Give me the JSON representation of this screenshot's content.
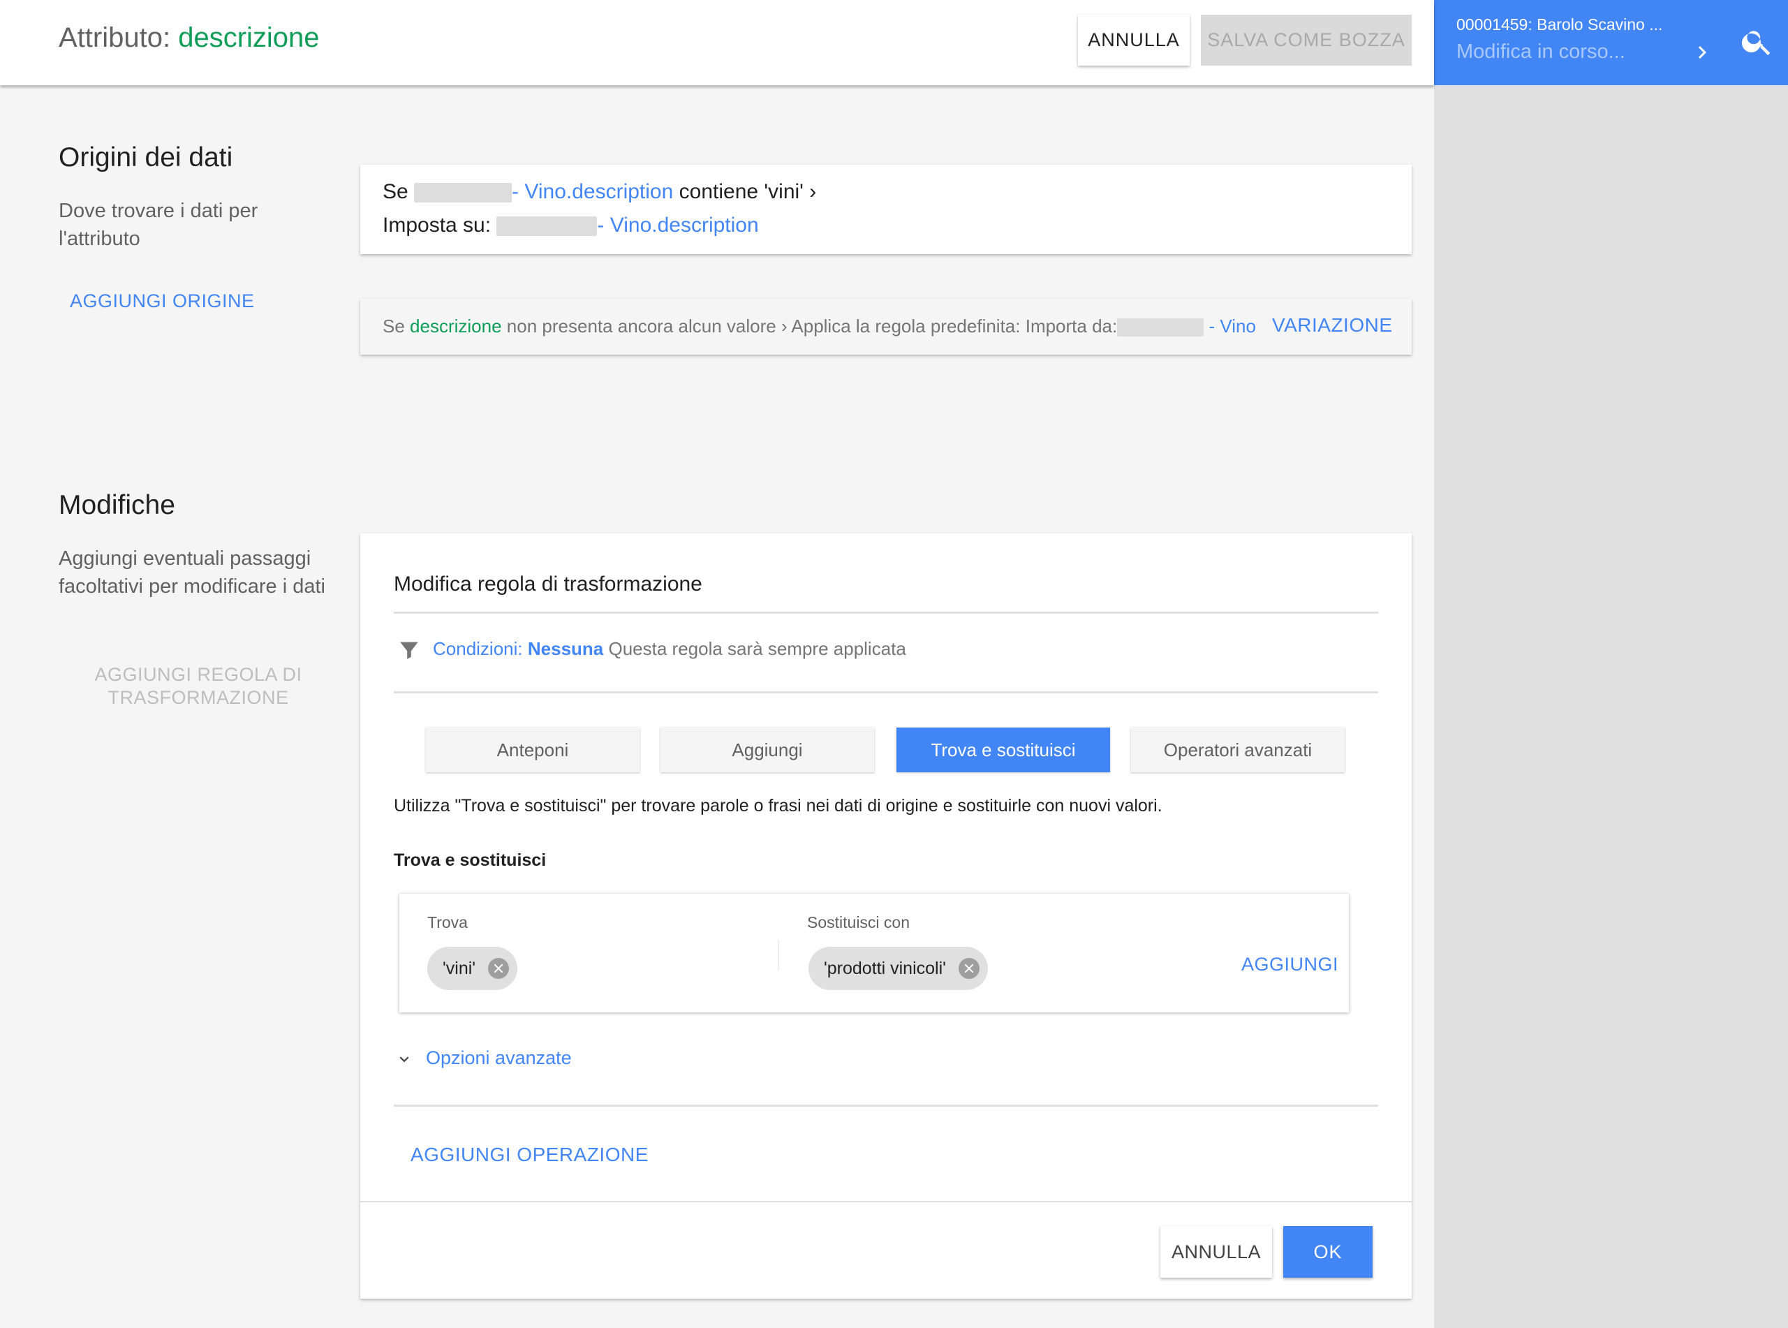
{
  "header": {
    "title_prefix": "Attributo:",
    "attribute_name": "descrizione",
    "cancel_label": "ANNULLA",
    "save_draft_label": "SALVA COME BOZZA"
  },
  "side_panel": {
    "record_title": "00001459: Barolo Scavino ...",
    "status": "Modifica in corso...",
    "icons": [
      "chevron-right-icon",
      "search-icon"
    ]
  },
  "sources_section": {
    "title": "Origini dei dati",
    "description": "Dove trovare i dati per l'attributo",
    "add_source_label": "AGGIUNGI ORIGINE",
    "rule": {
      "if_word": "Se",
      "source_field": "- Vino.description",
      "condition": "contiene",
      "value": "'vini'",
      "arrow": "›",
      "set_label": "Imposta su:",
      "target_field": "- Vino.description"
    },
    "default_rule": {
      "if_word": "Se",
      "attribute": "descrizione",
      "text": "non presenta ancora alcun valore › Applica la regola predefinita: Importa da:",
      "source": "- Vino",
      "variation_label": "VARIAZIONE"
    }
  },
  "modifications_section": {
    "title": "Modifiche",
    "description": "Aggiungi eventuali passaggi facoltativi per modificare i dati",
    "add_rule_label": "AGGIUNGI REGOLA DI TRASFORMAZIONE"
  },
  "rule_editor": {
    "title": "Modifica regola di trasformazione",
    "conditions_label": "Condizioni:",
    "conditions_value": "Nessuna",
    "conditions_note": "Questa regola sarà sempre applicata",
    "tabs": [
      {
        "label": "Anteponi",
        "active": false
      },
      {
        "label": "Aggiungi",
        "active": false
      },
      {
        "label": "Trova e sostituisci",
        "active": true
      },
      {
        "label": "Operatori avanzati",
        "active": false
      }
    ],
    "intro": "Utilizza \"Trova e sostituisci\" per trovare parole o frasi nei dati di origine e sostituirle con nuovi valori.",
    "subheading": "Trova e sostituisci",
    "find_label": "Trova",
    "find_chip": "'vini'",
    "replace_label": "Sostituisci con",
    "replace_chip": "'prodotti vinicoli'",
    "add_label": "AGGIUNGI",
    "advanced_options_label": "Opzioni avanzate",
    "add_operation_label": "AGGIUNGI OPERAZIONE",
    "cancel_label": "ANNULLA",
    "ok_label": "OK"
  },
  "colors": {
    "accent": "#4285f4",
    "attribute_green": "#0f9d58",
    "page_bg": "#f5f5f5",
    "side_panel_bg": "#e0e0e0"
  }
}
